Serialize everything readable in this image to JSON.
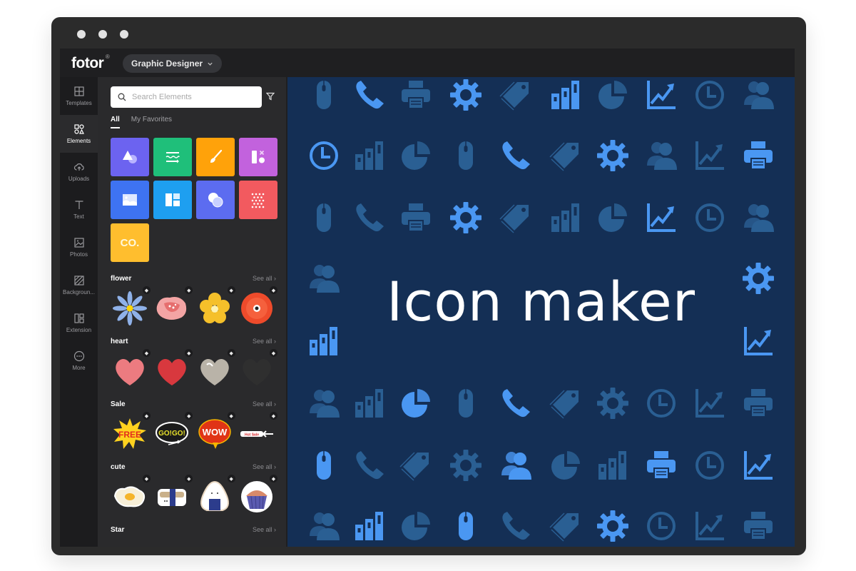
{
  "window": {
    "controls": [
      "dot",
      "dot",
      "dot"
    ]
  },
  "header": {
    "logo": "fotor",
    "logo_mark": "®",
    "mode_dropdown": {
      "label": "Graphic Designer",
      "icon": "chevron-down-icon"
    }
  },
  "nav": {
    "items": [
      {
        "label": "Templates",
        "icon": "templates-icon",
        "active": false
      },
      {
        "label": "Elements",
        "icon": "elements-icon",
        "active": true
      },
      {
        "label": "Uploads",
        "icon": "upload-cloud-icon",
        "active": false
      },
      {
        "label": "Text",
        "icon": "text-icon",
        "active": false
      },
      {
        "label": "Photos",
        "icon": "photo-icon",
        "active": false
      },
      {
        "label": "Backgroun...",
        "icon": "background-icon",
        "active": false
      },
      {
        "label": "Extension",
        "icon": "extension-icon",
        "active": false
      },
      {
        "label": "More",
        "icon": "more-icon",
        "active": false
      }
    ]
  },
  "panel": {
    "search": {
      "placeholder": "Search Elements",
      "value": ""
    },
    "filter_icon": "filter-icon",
    "tabs": [
      {
        "label": "All",
        "active": true
      },
      {
        "label": "My Favorites",
        "active": false
      }
    ],
    "categories": [
      {
        "name": "shapes",
        "color": "#6c63f0",
        "icon": "shapes-icon"
      },
      {
        "name": "lines",
        "color": "#1fbf7a",
        "icon": "lines-icon"
      },
      {
        "name": "illustrations",
        "color": "#ffa20a",
        "icon": "brush-icon"
      },
      {
        "name": "icons",
        "color": "#c262dd",
        "icon": "icons-icon"
      },
      {
        "name": "photos",
        "color": "#3e73f2",
        "icon": "image-icon"
      },
      {
        "name": "frames",
        "color": "#1e9ff0",
        "icon": "frames-icon"
      },
      {
        "name": "overlays",
        "color": "#5c6cf0",
        "icon": "overlay-icon"
      },
      {
        "name": "patterns",
        "color": "#f25a5f",
        "icon": "pattern-icon"
      },
      {
        "name": "logos",
        "color": "#ffbe2e",
        "icon": "co-icon",
        "text": "CO."
      }
    ],
    "see_all_label": "See all",
    "sections": [
      {
        "title": "flower",
        "items": [
          "blue-daisy",
          "pink-poppy",
          "yellow-flower",
          "red-poppy"
        ]
      },
      {
        "title": "heart",
        "items": [
          "pink-heart",
          "red-heart",
          "silver-heart",
          "black-heart"
        ]
      },
      {
        "title": "Sale",
        "items": [
          "free-burst",
          "gogo-bubble",
          "wow-bubble",
          "hot-sale-tag"
        ]
      },
      {
        "title": "cute",
        "items": [
          "fried-egg",
          "sushi",
          "onigiri",
          "cupcake"
        ]
      },
      {
        "title": "Star",
        "items": []
      }
    ],
    "sticker_texts": {
      "free": "FREE",
      "gogo": "GO!GO!",
      "wow": "WOW",
      "hot": "Hot Sale"
    }
  },
  "canvas": {
    "headline": "Icon maker",
    "background": "#142f55",
    "icon_colors": {
      "bright": "#4a97f2",
      "muted": "#2a5f93"
    },
    "icon_grid": [
      [
        [
          "mouse",
          "m"
        ],
        [
          "phone",
          "b"
        ],
        [
          "printer",
          "m"
        ],
        [
          "gear",
          "b"
        ],
        [
          "tag",
          "m"
        ],
        [
          "bars",
          "b"
        ],
        [
          "pie",
          "m"
        ],
        [
          "trend",
          "b"
        ],
        [
          "clock",
          "m"
        ],
        [
          "users",
          "m"
        ]
      ],
      [
        [
          "clock",
          "b"
        ],
        [
          "bars",
          "m"
        ],
        [
          "pie",
          "m"
        ],
        [
          "mouse",
          "m"
        ],
        [
          "phone",
          "b"
        ],
        [
          "tag",
          "m"
        ],
        [
          "gear",
          "b"
        ],
        [
          "users",
          "m"
        ],
        [
          "trend",
          "m"
        ],
        [
          "printer",
          "b"
        ]
      ],
      [
        [
          "mouse",
          "m"
        ],
        [
          "phone",
          "m"
        ],
        [
          "printer",
          "m"
        ],
        [
          "gear",
          "b"
        ],
        [
          "tag",
          "m"
        ],
        [
          "bars",
          "m"
        ],
        [
          "pie",
          "m"
        ],
        [
          "trend",
          "b"
        ],
        [
          "clock",
          "m"
        ],
        [
          "users",
          "m"
        ]
      ],
      [
        [
          "users",
          "m"
        ],
        null,
        null,
        null,
        null,
        null,
        null,
        null,
        null,
        [
          "gear",
          "b"
        ]
      ],
      [
        [
          "bars",
          "b"
        ],
        null,
        null,
        null,
        null,
        null,
        null,
        null,
        null,
        [
          "trend",
          "b"
        ]
      ],
      [
        [
          "users",
          "m"
        ],
        [
          "bars",
          "m"
        ],
        [
          "pie",
          "b"
        ],
        [
          "mouse",
          "m"
        ],
        [
          "phone",
          "b"
        ],
        [
          "tag",
          "m"
        ],
        [
          "gear",
          "m"
        ],
        [
          "clock",
          "m"
        ],
        [
          "trend",
          "m"
        ],
        [
          "printer",
          "m"
        ]
      ],
      [
        [
          "mouse",
          "b"
        ],
        [
          "phone",
          "m"
        ],
        [
          "tag",
          "m"
        ],
        [
          "gear",
          "m"
        ],
        [
          "users",
          "b"
        ],
        [
          "pie",
          "m"
        ],
        [
          "bars",
          "m"
        ],
        [
          "printer",
          "b"
        ],
        [
          "clock",
          "m"
        ],
        [
          "trend",
          "b"
        ]
      ],
      [
        [
          "users",
          "m"
        ],
        [
          "bars",
          "b"
        ],
        [
          "pie",
          "m"
        ],
        [
          "mouse",
          "b"
        ],
        [
          "phone",
          "m"
        ],
        [
          "tag",
          "m"
        ],
        [
          "gear",
          "b"
        ],
        [
          "clock",
          "m"
        ],
        [
          "trend",
          "m"
        ],
        [
          "printer",
          "m"
        ]
      ]
    ]
  }
}
